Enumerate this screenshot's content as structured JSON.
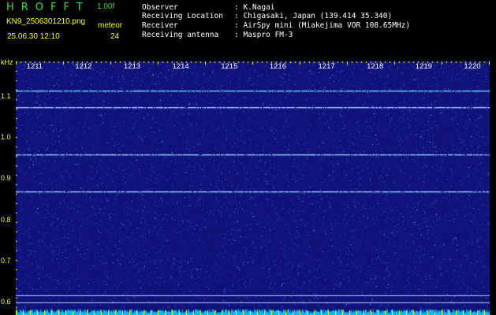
{
  "header": {
    "app_title": "HROFFT",
    "version": "1.00f",
    "filename": "KN9_2506301210.png",
    "mode": "meteor",
    "datetime": "25.06.30 12:10",
    "interval": "24"
  },
  "station_info": [
    {
      "label": "Observer",
      "value": "K.Nagai"
    },
    {
      "label": "Receiving Location",
      "value": "Chigasaki, Japan (139.414 35.340)"
    },
    {
      "label": "Receiver",
      "value": "AirSpy mini (Miakejima VOR 108.65MHz)"
    },
    {
      "label": "Receiving antenna",
      "value": "Maspro FM-3"
    }
  ],
  "spectrogram": {
    "y_unit": "kHz",
    "y_ticks": [
      "1.1",
      "1.0",
      "0.9",
      "0.8",
      "0.7",
      "0.6"
    ],
    "y_tick_values": [
      1.1,
      1.0,
      0.9,
      0.8,
      0.7,
      0.6
    ],
    "y_range": [
      0.57,
      1.185
    ],
    "x_ticks": [
      "1211",
      "1212",
      "1213",
      "1214",
      "1215",
      "1216",
      "1217",
      "1218",
      "1219",
      "1220"
    ],
    "x_range": [
      1210.6,
      1220.35
    ],
    "carrier_lines_khz": [
      1.115,
      1.075,
      0.96,
      0.87
    ],
    "reference_lines_khz": [
      0.618,
      0.6
    ],
    "colors": {
      "background": "#10127a",
      "noise": "#3a4cd0",
      "carrier": "#a0f0ff",
      "tick": "#ffff00",
      "baseline": "#00c8ff"
    }
  }
}
